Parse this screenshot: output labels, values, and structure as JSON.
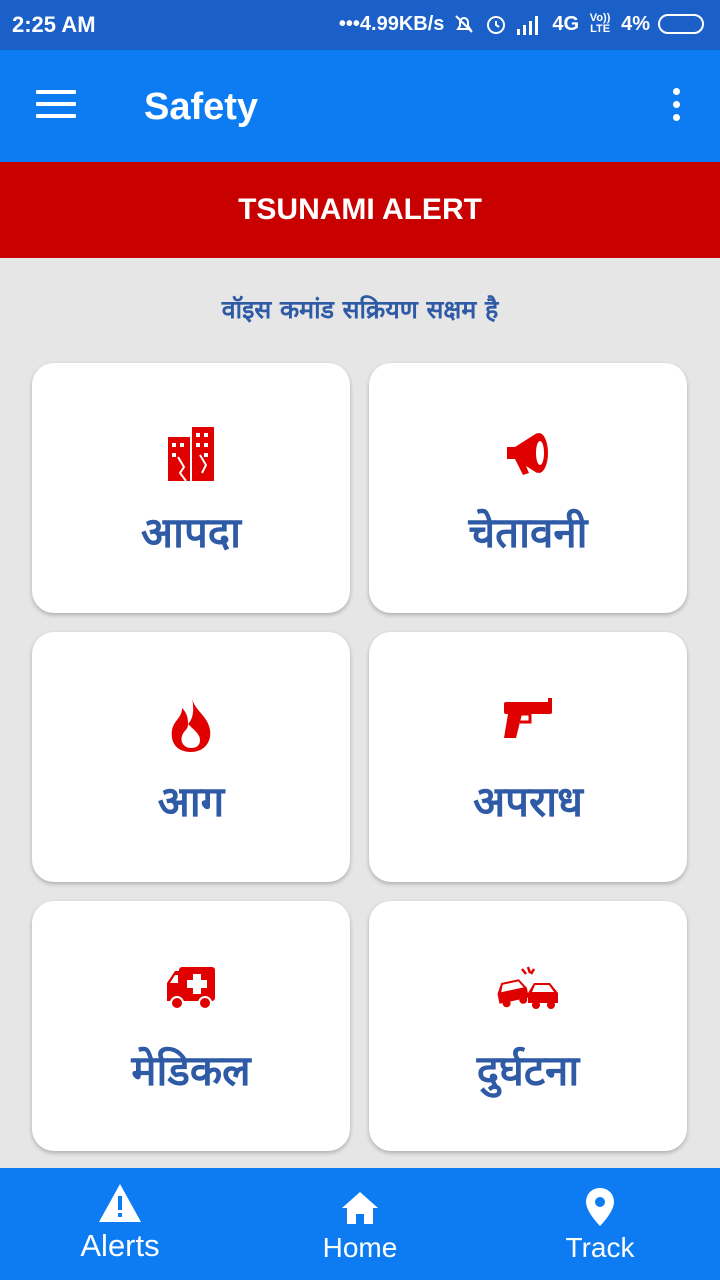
{
  "status_bar": {
    "time": "2:25 AM",
    "network_speed": "•••4.99KB/s",
    "network_type": "4G",
    "volte": "Vo)) LTE",
    "battery": "4%"
  },
  "app_bar": {
    "title": "Safety",
    "menu_icon": "hamburger-menu-icon",
    "more_icon": "more-vertical-icon"
  },
  "alert_banner": {
    "text": "TSUNAMI ALERT",
    "color": "#c90000"
  },
  "voice_status": "वॉइस कमांड सक्रियण सक्षम है",
  "categories": [
    {
      "label": "आपदा",
      "icon": "collapsed-building-icon"
    },
    {
      "label": "चेतावनी",
      "icon": "megaphone-icon"
    },
    {
      "label": "आग",
      "icon": "fire-icon"
    },
    {
      "label": "अपराध",
      "icon": "gun-icon"
    },
    {
      "label": "मेडिकल",
      "icon": "ambulance-icon"
    },
    {
      "label": "दुर्घटना",
      "icon": "car-crash-icon"
    }
  ],
  "bottom_nav": [
    {
      "label": "Alerts",
      "icon": "warning-icon",
      "active": true
    },
    {
      "label": "Home",
      "icon": "home-icon",
      "active": false
    },
    {
      "label": "Track",
      "icon": "location-pin-icon",
      "active": false
    }
  ],
  "colors": {
    "primary": "#0d7cf2",
    "status_bar": "#1b5fc9",
    "accent_red": "#e00000",
    "label_blue": "#2e5aa6"
  }
}
